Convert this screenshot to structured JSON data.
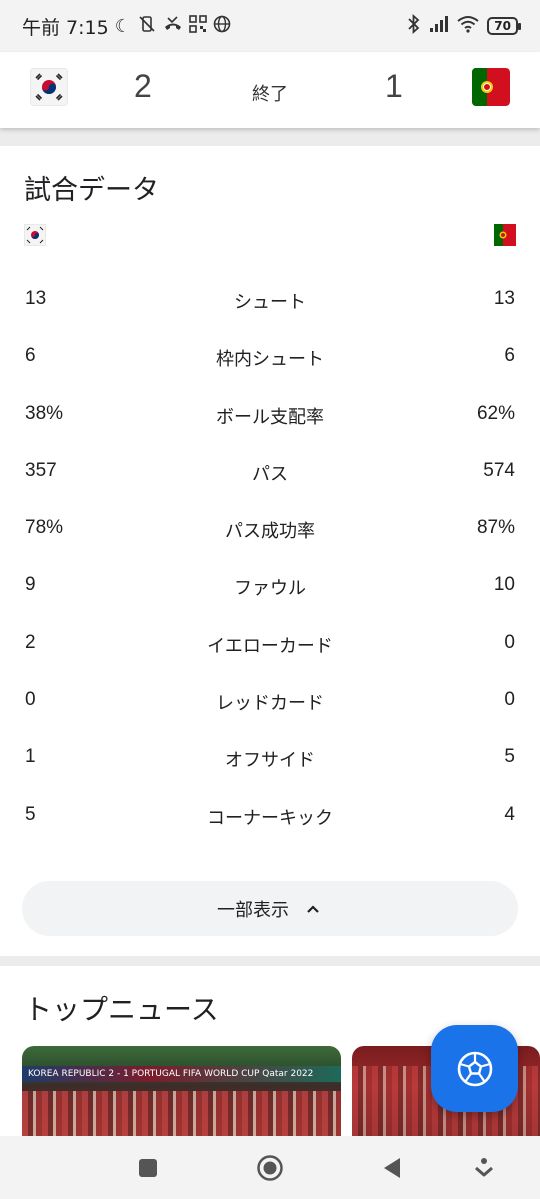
{
  "status_bar": {
    "time": "午前 7:15",
    "battery": "70",
    "icons_left": [
      "moon-icon",
      "vibrate-off-icon",
      "missed-call-icon",
      "qr-icon",
      "globe-icon"
    ],
    "icons_right": [
      "bluetooth-icon",
      "signal-icon",
      "wifi-icon",
      "battery-icon"
    ]
  },
  "scoreboard": {
    "home_team_flag": "south-korea-flag",
    "away_team_flag": "portugal-flag",
    "home_score": "2",
    "away_score": "1",
    "match_status": "終了"
  },
  "match_stats": {
    "title": "試合データ",
    "home_flag": "south-korea-flag",
    "away_flag": "portugal-flag",
    "rows": [
      {
        "label": "シュート",
        "home": "13",
        "away": "13"
      },
      {
        "label": "枠内シュート",
        "home": "6",
        "away": "6"
      },
      {
        "label": "ボール支配率",
        "home": "38%",
        "away": "62%"
      },
      {
        "label": "パス",
        "home": "357",
        "away": "574"
      },
      {
        "label": "パス成功率",
        "home": "78%",
        "away": "87%"
      },
      {
        "label": "ファウル",
        "home": "9",
        "away": "10"
      },
      {
        "label": "イエローカード",
        "home": "2",
        "away": "0"
      },
      {
        "label": "レッドカード",
        "home": "0",
        "away": "0"
      },
      {
        "label": "オフサイド",
        "home": "1",
        "away": "5"
      },
      {
        "label": "コーナーキック",
        "home": "5",
        "away": "4"
      }
    ],
    "collapse_button": "一部表示"
  },
  "top_news": {
    "title": "トップニュース",
    "thumb1_banner": "KOREA REPUBLIC  2 - 1  PORTUGAL    FIFA WORLD CUP Qatar 2022"
  },
  "fab": {
    "icon": "soccer-ball-icon"
  },
  "colors": {
    "accent": "#1a73e8",
    "background": "#ececec",
    "card": "#ffffff"
  }
}
